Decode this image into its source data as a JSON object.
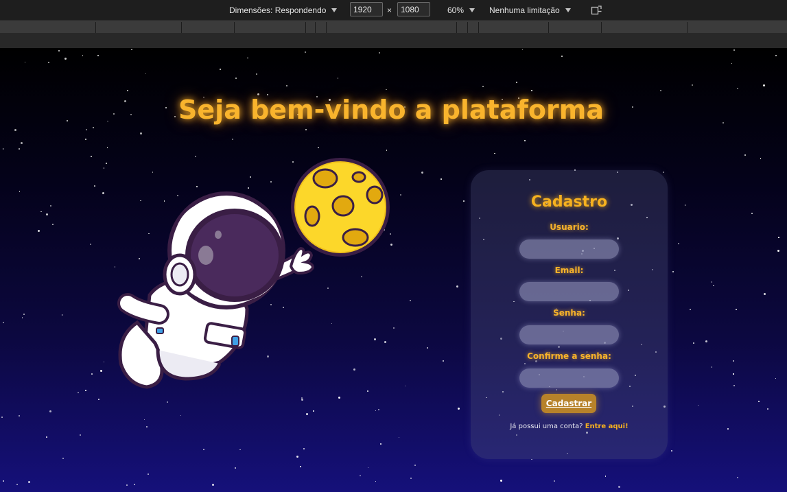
{
  "devtools": {
    "dimensions_label": "Dimensões: Respondendo",
    "width_value": "1920",
    "times": "×",
    "height_value": "1080",
    "zoom": "60%",
    "throttle": "Nenhuma limitação",
    "rotate_icon": "rotate-icon"
  },
  "page": {
    "headline": "Seja bem-vindo a plataforma",
    "illustration": "astronaut-reaching-moon",
    "form": {
      "title": "Cadastro",
      "user_label": "Usuario:",
      "email_label": "Email:",
      "password_label": "Senha:",
      "confirm_label": "Confirme a senha:",
      "submit_label": "Cadastrar",
      "login_prompt": "Já possui uma conta?",
      "login_link": "Entre aqui!"
    }
  },
  "colors": {
    "accent": "#f6b11f",
    "button": "#b7822a",
    "sky_top": "#000000",
    "sky_bottom": "#15107a"
  }
}
